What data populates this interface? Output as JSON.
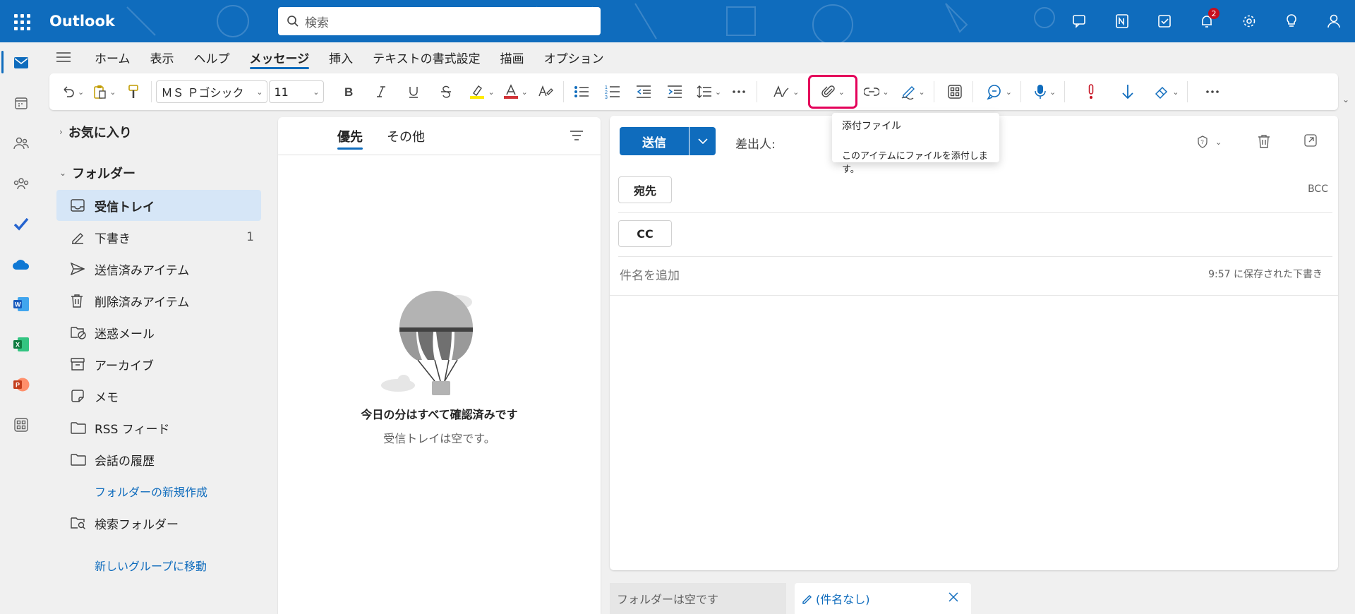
{
  "app": {
    "name": "Outlook"
  },
  "search": {
    "placeholder": "検索"
  },
  "notifications": {
    "count": "2"
  },
  "ribbon_tabs": [
    "ホーム",
    "表示",
    "ヘルプ",
    "メッセージ",
    "挿入",
    "テキストの書式設定",
    "描画",
    "オプション"
  ],
  "active_tab": "メッセージ",
  "ribbon": {
    "font_name": "ＭＳ Ｐゴシック",
    "font_size": "11"
  },
  "tooltip": {
    "title": "添付ファイル",
    "description": "このアイテムにファイルを添付します。"
  },
  "folders": {
    "favorites": "お気に入り",
    "section": "フォルダー",
    "items": [
      {
        "label": "受信トレイ",
        "icon": "inbox-icon",
        "count": ""
      },
      {
        "label": "下書き",
        "icon": "draft-icon",
        "count": "1"
      },
      {
        "label": "送信済みアイテム",
        "icon": "sent-icon",
        "count": ""
      },
      {
        "label": "削除済みアイテム",
        "icon": "trash-icon",
        "count": ""
      },
      {
        "label": "迷惑メール",
        "icon": "junk-icon",
        "count": ""
      },
      {
        "label": "アーカイブ",
        "icon": "archive-icon",
        "count": ""
      },
      {
        "label": "メモ",
        "icon": "note-icon",
        "count": ""
      },
      {
        "label": "RSS フィード",
        "icon": "folder-icon",
        "count": ""
      },
      {
        "label": "会話の履歴",
        "icon": "folder-icon",
        "count": ""
      }
    ],
    "new_folder": "フォルダーの新規作成",
    "search_folder": "検索フォルダー",
    "new_group": "新しいグループに移動"
  },
  "message_list": {
    "tabs": [
      "優先",
      "その他"
    ],
    "empty_title": "今日の分はすべて確認済みです",
    "empty_subtitle": "受信トレイは空です。"
  },
  "compose": {
    "send": "送信",
    "from_label": "差出人:",
    "to": "宛先",
    "cc": "CC",
    "bcc": "BCC",
    "subject_placeholder": "件名を追加",
    "saved_status": "9:57 に保存された下書き"
  },
  "bottom": {
    "folder_empty": "フォルダーは空です",
    "draft_tab": "(件名なし)"
  },
  "colors": {
    "brand": "#0f6cbd",
    "highlight": "#e4005a"
  }
}
